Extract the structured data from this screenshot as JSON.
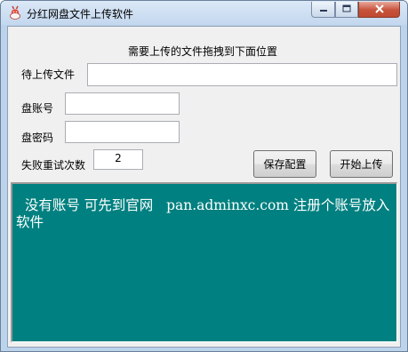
{
  "window": {
    "title": "分红网盘文件上传软件",
    "controls": {
      "minimize_icon": "minimize-icon",
      "maximize_icon": "maximize-icon",
      "close_icon": "close-icon"
    }
  },
  "form": {
    "instruction": "需要上传的文件拖拽到下面位置",
    "file_label": "待上传文件",
    "file_value": "",
    "account_label": "盘账号",
    "account_value": "",
    "password_label": "盘密码",
    "password_value": "",
    "retry_label": "失败重试次数",
    "retry_value": "2",
    "save_button": "保存配置",
    "upload_button": "开始上传"
  },
  "dropzone": {
    "text": "  没有账号 可先到官网   pan.adminxc.com 注册个账号放入软件",
    "background": "#008080",
    "text_color": "#ffffff"
  }
}
